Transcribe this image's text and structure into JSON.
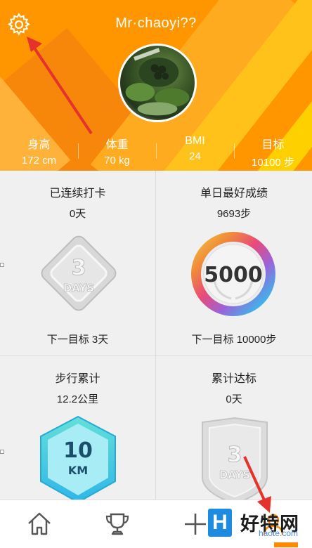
{
  "header": {
    "user_name": "Mr·chaoyi??",
    "stats": [
      {
        "label": "身高",
        "value": "172 cm"
      },
      {
        "label": "体重",
        "value": "70 kg"
      },
      {
        "label": "BMI",
        "value": "24"
      },
      {
        "label": "目标",
        "value": "10100 步"
      }
    ]
  },
  "cards": [
    {
      "title": "已连续打卡",
      "value": "0天",
      "badge_top": "3",
      "badge_bottom": "DAYS",
      "next": "下一目标  3天"
    },
    {
      "title": "单日最好成绩",
      "value": "9693步",
      "badge_top": "5000",
      "next": "下一目标 10000步"
    },
    {
      "title": "步行累计",
      "value": "12.2公里",
      "badge_top": "10",
      "badge_bottom": "KM"
    },
    {
      "title": "累计达标",
      "value": "0天",
      "badge_top": "3",
      "badge_bottom": "DAYS"
    }
  ],
  "nav": [
    {
      "icon": "home-icon"
    },
    {
      "icon": "trophy-icon"
    },
    {
      "icon": "plus-icon"
    },
    {
      "icon": "profile-icon"
    }
  ],
  "watermark": {
    "logo": "H",
    "text": "好特网",
    "sub": "haote.com"
  },
  "colors": {
    "header": "#ff9600",
    "accent_yellow": "#ffc21a",
    "arrow": "#e5322d",
    "km_badge": "#3ec6e6"
  }
}
